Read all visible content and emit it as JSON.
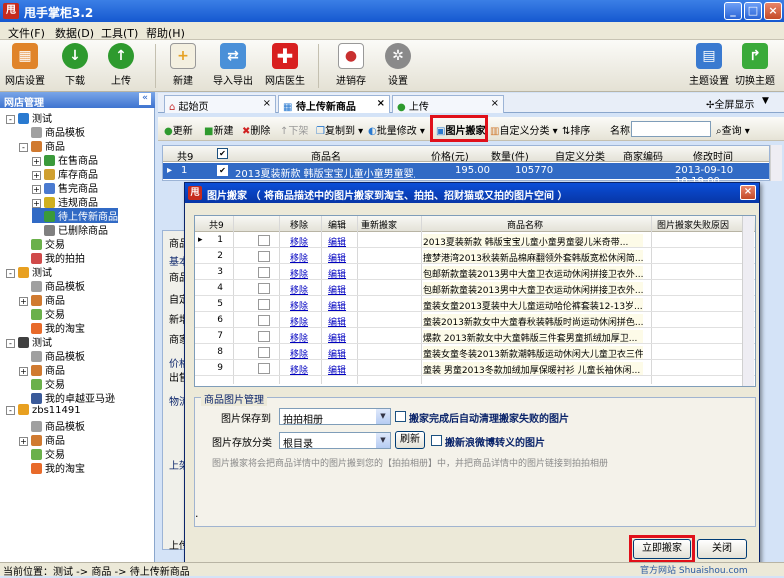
{
  "window": {
    "title": "甩手掌柜3.2",
    "min_label": "_",
    "max_label": "□",
    "close_label": "×"
  },
  "menu": [
    "文件(F)",
    "数据(D)",
    "工具(T)",
    "帮助(H)"
  ],
  "toolbar": {
    "left": [
      {
        "label": "网店设置",
        "icon": "store-settings-icon",
        "color": "#e0842a"
      },
      {
        "label": "下载",
        "icon": "download-icon",
        "color": "#2e9a2e"
      },
      {
        "label": "上传",
        "icon": "upload-icon",
        "color": "#2e9a2e"
      },
      {
        "label": "新建",
        "icon": "new-document-icon",
        "color": "#e6a020"
      },
      {
        "label": "导入导出",
        "icon": "import-export-icon",
        "color": "#4a90d8"
      },
      {
        "label": "网店医生",
        "icon": "red-cross-icon",
        "color": "#d82020"
      },
      {
        "label": "进销存",
        "icon": "inventory-icon",
        "color": "#c83030"
      },
      {
        "label": "设置",
        "icon": "gear-icon",
        "color": "#8a8a8a"
      }
    ],
    "right": [
      {
        "label": "主题设置",
        "icon": "theme-folder-icon",
        "color": "#3a7ad0"
      },
      {
        "label": "切换主题",
        "icon": "switch-arrow-icon",
        "color": "#3aaa3a"
      }
    ]
  },
  "left_panel": {
    "title": "网店管理",
    "collapse_label": "«",
    "tree": [
      {
        "label": "测试",
        "level": 0,
        "icon": "globe-icon",
        "color": "#2a7ad0",
        "expand": "-"
      },
      {
        "label": "商品模板",
        "level": 1,
        "icon": "template-icon",
        "color": "#a0a0a0",
        "expand": ""
      },
      {
        "label": "商品",
        "level": 1,
        "icon": "product-icon",
        "color": "#d07a30",
        "expand": "-"
      },
      {
        "label": "在售商品",
        "level": 2,
        "icon": "on-sale-icon",
        "color": "#3a9a3a",
        "expand": "+"
      },
      {
        "label": "库存商品",
        "level": 2,
        "icon": "stock-icon",
        "color": "#d0a030",
        "expand": "+"
      },
      {
        "label": "售完商品",
        "level": 2,
        "icon": "sold-out-icon",
        "color": "#4a7ad0",
        "expand": "+"
      },
      {
        "label": "违规商品",
        "level": 2,
        "icon": "violation-icon",
        "color": "#d0b020",
        "expand": "+"
      },
      {
        "label": "待上传新商品",
        "level": 2,
        "icon": "pending-upload-icon",
        "color": "#3a9a3a",
        "expand": "",
        "selected": true
      },
      {
        "label": "已删除商品",
        "level": 2,
        "icon": "deleted-icon",
        "color": "#808080",
        "expand": ""
      },
      {
        "label": "交易",
        "level": 1,
        "icon": "trade-icon",
        "color": "#6ab04a",
        "expand": ""
      },
      {
        "label": "我的拍拍",
        "level": 1,
        "icon": "paipai-icon",
        "color": "#d04a4a",
        "expand": ""
      },
      {
        "label": "测试",
        "level": 0,
        "icon": "sun-icon",
        "color": "#e8a020",
        "expand": "-"
      },
      {
        "label": "商品模板",
        "level": 1,
        "icon": "template-icon",
        "color": "#a0a0a0",
        "expand": ""
      },
      {
        "label": "商品",
        "level": 1,
        "icon": "product-icon",
        "color": "#d07a30",
        "expand": "+"
      },
      {
        "label": "交易",
        "level": 1,
        "icon": "trade-icon",
        "color": "#6ab04a",
        "expand": ""
      },
      {
        "label": "我的淘宝",
        "level": 1,
        "icon": "taobao-icon",
        "color": "#e86a2a",
        "expand": ""
      },
      {
        "label": "测试",
        "level": 0,
        "icon": "avatar-icon",
        "color": "#404040",
        "expand": "-"
      },
      {
        "label": "商品模板",
        "level": 1,
        "icon": "template-icon",
        "color": "#a0a0a0",
        "expand": ""
      },
      {
        "label": "商品",
        "level": 1,
        "icon": "product-icon",
        "color": "#d07a30",
        "expand": "+"
      },
      {
        "label": "交易",
        "level": 1,
        "icon": "trade-icon",
        "color": "#6ab04a",
        "expand": ""
      },
      {
        "label": "我的卓越亚马逊",
        "level": 1,
        "icon": "amazon-icon",
        "color": "#3a5a9a",
        "expand": ""
      },
      {
        "label": "zbs11491",
        "level": 0,
        "icon": "sun-icon",
        "color": "#e8a020",
        "expand": "-"
      },
      {
        "label": "商品模板",
        "level": 1,
        "icon": "template-icon",
        "color": "#a0a0a0",
        "expand": ""
      },
      {
        "label": "商品",
        "level": 1,
        "icon": "product-icon",
        "color": "#d07a30",
        "expand": "+"
      },
      {
        "label": "交易",
        "level": 1,
        "icon": "trade-icon",
        "color": "#6ab04a",
        "expand": ""
      },
      {
        "label": "我的淘宝",
        "level": 1,
        "icon": "taobao-icon",
        "color": "#e86a2a",
        "expand": ""
      }
    ]
  },
  "tabs": [
    {
      "label": "起始页",
      "close": "×"
    },
    {
      "label": "待上传新商品",
      "close": "×",
      "active": true
    },
    {
      "label": "上传",
      "close": "×"
    }
  ],
  "tabs_right": {
    "fullscreen": "全屏显示",
    "dropdown": "▼"
  },
  "subtoolbar": {
    "refresh": "更新",
    "new": "新建",
    "delete": "删除",
    "download": "下架",
    "copy": "复制到",
    "batch": "批量修改",
    "image_move": "图片搬家",
    "custom_cat": "自定义分类",
    "sort": "排序",
    "name_label": "名称",
    "search": "查询"
  },
  "main_grid": {
    "total_label": "共9",
    "headers": [
      "商品名",
      "价格(元)",
      "数量(件)",
      "自定义分类",
      "商家编码",
      "修改时间"
    ],
    "row": {
      "num": "1",
      "name": "2013夏装新款 韩版宝宝儿童小童男童婴儿...",
      "price": "195.00",
      "qty": "105770",
      "custom": "",
      "code": "",
      "time": "2013-09-10 10:19:00"
    }
  },
  "lower_panel": {
    "labels": [
      "商品",
      "基本",
      "商品",
      "自定",
      "新増",
      "商家",
      "价格",
      "出售",
      "物流",
      "上架"
    ],
    "bottom": "上传"
  },
  "dialog": {
    "title": "图片搬家 （ 将商品描述中的图片搬家到淘宝、拍拍、招财猫或又拍的图片空间 ）",
    "close": "×",
    "grid": {
      "headers": {
        "total": "共9",
        "remove": "移除",
        "edit": "编辑",
        "remove_again": "重新搬家",
        "name": "商品名称",
        "fail": "图片搬家失败原因"
      },
      "rows": [
        {
          "num": "1",
          "remove": "移除",
          "edit": "编辑",
          "name": "2013夏装新款 韩版宝宝儿童小童男童婴儿米奇带..."
        },
        {
          "num": "2",
          "remove": "移除",
          "edit": "编辑",
          "name": "撞梦港湾2013秋装新品棉麻翻领外套韩版宽松休闲简..."
        },
        {
          "num": "3",
          "remove": "移除",
          "edit": "编辑",
          "name": "包邮新款童装2013男中大童卫衣运动休闲拼接卫衣外..."
        },
        {
          "num": "4",
          "remove": "移除",
          "edit": "编辑",
          "name": "包邮新款童装2013男中大童卫衣运动休闲拼接卫衣外..."
        },
        {
          "num": "5",
          "remove": "移除",
          "edit": "编辑",
          "name": "童装女童2013夏装中大儿童运动哈伦裤套装12-13岁..."
        },
        {
          "num": "6",
          "remove": "移除",
          "edit": "编辑",
          "name": "童装2013新款女中大童春秋装韩版时尚运动休闲拼色..."
        },
        {
          "num": "7",
          "remove": "移除",
          "edit": "编辑",
          "name": "爆款 2013新款女中大童韩版三件套男童抓绒加厚卫..."
        },
        {
          "num": "8",
          "remove": "移除",
          "edit": "编辑",
          "name": "童装女童冬装2013新款潮韩版运动休闲大儿童卫衣三件套..."
        },
        {
          "num": "9",
          "remove": "移除",
          "edit": "编辑",
          "name": "童装 男童2013冬款加绒加厚保暖衬衫 儿童长袖休闲..."
        }
      ]
    },
    "group": {
      "legend": "商品图片管理",
      "save_to_label": "图片保存到",
      "save_to_value": "拍拍相册",
      "checkbox1": "搬家完成后自动清理搬家失败的图片",
      "category_label": "图片存放分类",
      "category_value": "根目录",
      "refresh_button": "刷新",
      "checkbox2": "搬新浪微博转义的图片",
      "note": "图片搬家将会把商品详情中的图片搬到您的【拍拍相册】中，并把商品详情中的图片链接到拍拍相册"
    },
    "start_button": "立即搬家",
    "close_button": "关闭",
    "dot_marker": "."
  },
  "statusbar": {
    "text": "当前位置：测试 -> 商品 -> 待上传新商品"
  },
  "watermark": "官方网站 Shuaishou.com",
  "colors": {
    "highlight": "#e0101a",
    "title_blue": "#1558d0",
    "selection": "#316ac5"
  }
}
